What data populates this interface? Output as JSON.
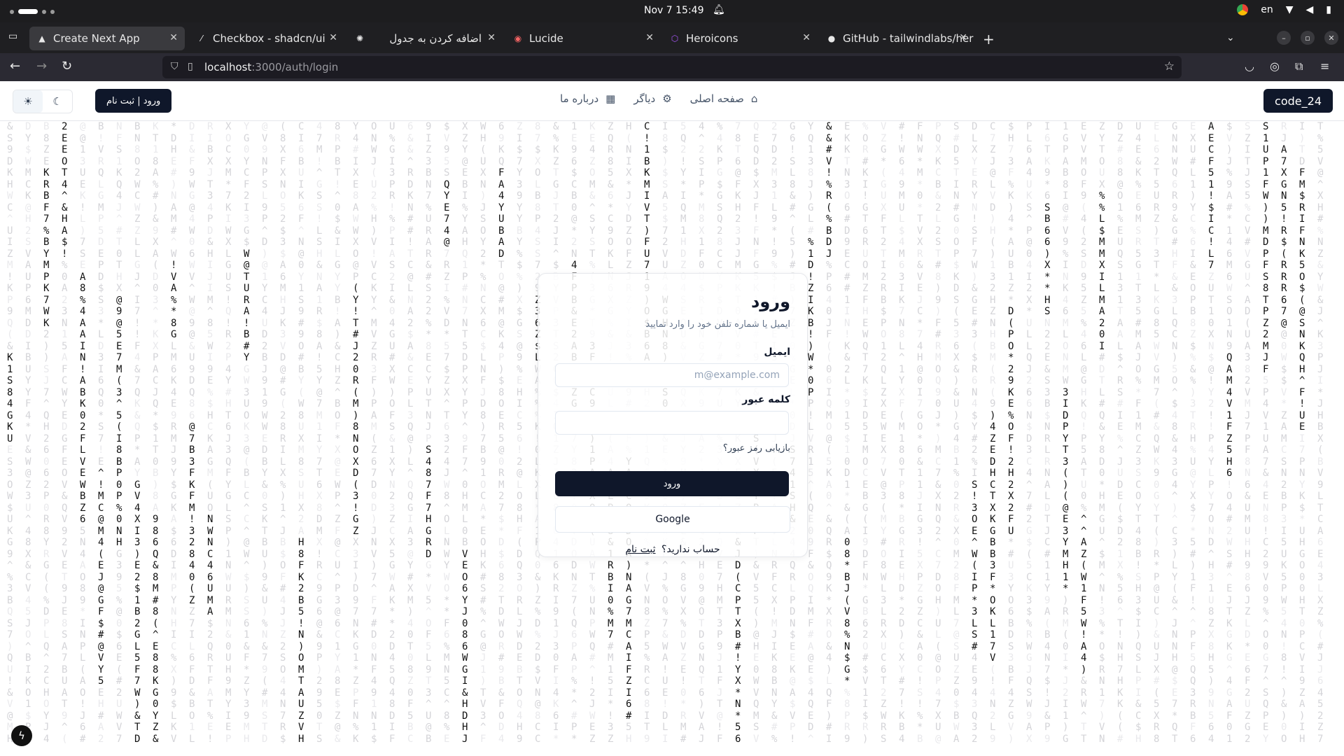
{
  "os": {
    "clock": "Nov 7  15:49",
    "lang": "en"
  },
  "tabs": [
    {
      "label": "Create Next App",
      "icon": "nextjs-icon",
      "active": true
    },
    {
      "label": "Checkbox - shadcn/ui",
      "icon": "shadcn-icon"
    },
    {
      "label": "اضافه کردن به جدول",
      "icon": "openai-icon"
    },
    {
      "label": "Lucide",
      "icon": "lucide-icon"
    },
    {
      "label": "Heroicons",
      "icon": "heroicons-icon"
    },
    {
      "label": "GitHub - tailwindlabs/her",
      "icon": "github-icon"
    }
  ],
  "address": {
    "host": "localhost",
    "path": ":3000/auth/login"
  },
  "header": {
    "brand": "code_24",
    "nav": [
      {
        "label": "صفحه اصلی",
        "icon": "home-icon"
      },
      {
        "label": "دیاگر",
        "icon": "gear-icon"
      },
      {
        "label": "درباره ما",
        "icon": "building-icon"
      }
    ],
    "login_button": "ورود | ثبت نام"
  },
  "login": {
    "title": "ورود",
    "subtitle": "ایمیل یا شماره تلفن خود را وارد نمایید",
    "email_label": "ایمیل",
    "email_placeholder": "m@example.com",
    "password_label": "کلمه عبور",
    "forgot": "بازیابی رمز عبور؟",
    "submit": "ورود",
    "google": "Google",
    "no_account": "حساب ندارید؟",
    "signup": "ثبت نام"
  },
  "colors": {
    "primary": "#0f172a",
    "browser_chrome": "#1f1f22"
  }
}
